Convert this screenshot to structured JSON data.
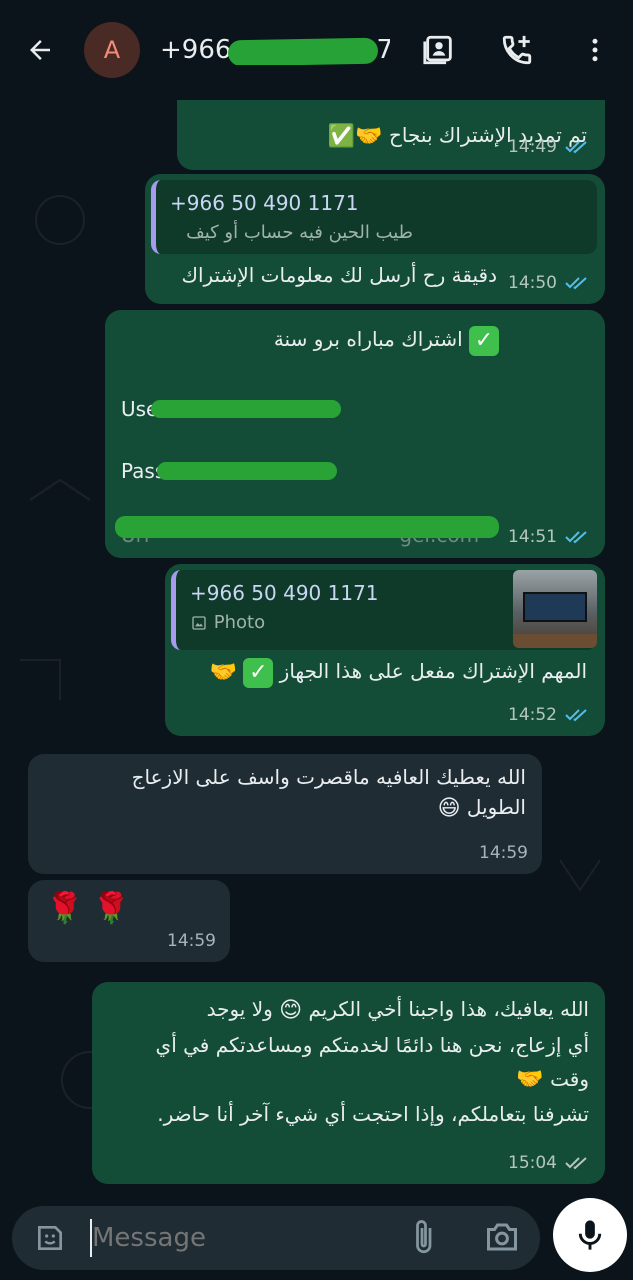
{
  "header": {
    "back_icon": "arrow-left-icon",
    "avatar_letter": "A",
    "contact_title": "+966",
    "icons": [
      "contact-card-icon",
      "add-call-icon",
      "more-vert-icon"
    ]
  },
  "messages": [
    {
      "id": "m1",
      "text": "تم تمديد الإشتراك بنجاح",
      "emoji": "🤝✅",
      "time": "14:49"
    },
    {
      "id": "m2",
      "quote_name": "+966 50 490 1171",
      "quote_text": "طيب الحين فيه حساب أو كيف",
      "text": "دقيقة رح أرسل لك معلومات الإشتراك",
      "time": "14:50"
    },
    {
      "id": "m3",
      "title": "اشتراك مباراه برو سنة",
      "user_label": "Use",
      "pass_label": "Pass",
      "url_label": "Url",
      "url_tail": "gel.com",
      "time": "14:51"
    },
    {
      "id": "m4",
      "quote_name": "+966 50 490 1171",
      "quote_text": "Photo",
      "text": "المهم الإشتراك مفعل على هذا الجهاز",
      "time": "14:52"
    },
    {
      "id": "m5",
      "line1": "الله يعطيك العافيه ماقصرت واسف على الازعاج",
      "line2": "الطويل",
      "emoji": "😄",
      "time": "14:59"
    },
    {
      "id": "m6",
      "emoji": "🌹 🌹",
      "time": "14:59"
    },
    {
      "id": "m7",
      "line1": "الله يعافيك، هذا واجبنا أخي الكريم",
      "line1b": "ولا يوجد",
      "line2": "أي إزعاج، نحن هنا دائمًا لخدمتكم ومساعدتكم في أي",
      "line3": "وقت",
      "line4": "تشرفنا بتعاملكم، وإذا احتجت أي شيء آخر أنا حاضر.",
      "time": "15:04"
    }
  ],
  "composer": {
    "placeholder": "Message",
    "icons": [
      "emoji-sticker-icon",
      "attach-icon",
      "camera-icon",
      "mic-icon"
    ]
  },
  "colors": {
    "outgoing": "#144d37",
    "incoming": "#1f2c34",
    "tick_read": "#53bdeb"
  }
}
